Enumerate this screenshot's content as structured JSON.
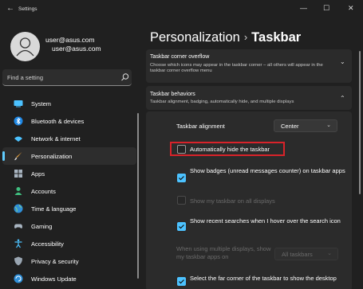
{
  "window": {
    "back_glyph": "←",
    "title": "Settings",
    "minimize_glyph": "—",
    "maximize_glyph": "☐",
    "close_glyph": "✕"
  },
  "account": {
    "email_line1": "user@asus.com",
    "email_line2": "user@asus.com"
  },
  "search": {
    "placeholder": "Find a setting"
  },
  "sidebar": {
    "items": [
      {
        "label": "System",
        "icon": "monitor-icon",
        "active": false
      },
      {
        "label": "Bluetooth & devices",
        "icon": "bluetooth-icon",
        "active": false
      },
      {
        "label": "Network & internet",
        "icon": "wifi-icon",
        "active": false
      },
      {
        "label": "Personalization",
        "icon": "brush-icon",
        "active": true
      },
      {
        "label": "Apps",
        "icon": "apps-icon",
        "active": false
      },
      {
        "label": "Accounts",
        "icon": "person-icon",
        "active": false
      },
      {
        "label": "Time & language",
        "icon": "globe-icon",
        "active": false
      },
      {
        "label": "Gaming",
        "icon": "controller-icon",
        "active": false
      },
      {
        "label": "Accessibility",
        "icon": "accessibility-icon",
        "active": false
      },
      {
        "label": "Privacy & security",
        "icon": "shield-icon",
        "active": false
      },
      {
        "label": "Windows Update",
        "icon": "update-icon",
        "active": false
      }
    ]
  },
  "breadcrumb": {
    "parent": "Personalization",
    "separator": "›",
    "current": "Taskbar"
  },
  "overflow_card": {
    "title": "Taskbar corner overflow",
    "subtitle": "Choose which icons may appear in the taskbar corner – all others will appear in the taskbar corner overflow menu",
    "chevron": "⌄"
  },
  "behaviors_card": {
    "title": "Taskbar behaviors",
    "subtitle": "Taskbar alignment, badging, automatically hide, and multiple displays",
    "chevron": "⌃"
  },
  "settings": {
    "alignment_label": "Taskbar alignment",
    "alignment_value": "Center",
    "autohide_label": "Automatically hide the taskbar",
    "autohide_checked": false,
    "badges_label": "Show badges (unread messages counter) on taskbar apps",
    "badges_checked": true,
    "all_displays_label": "Show my taskbar on all displays",
    "all_displays_checked": false,
    "recent_searches_label": "Show recent searches when I hover over the search icon",
    "recent_searches_checked": true,
    "multi_display_label": "When using multiple displays, show my taskbar apps on",
    "multi_display_value": "All taskbars",
    "far_corner_label": "Select the far corner of the taskbar to show the desktop",
    "far_corner_checked": true
  },
  "colors": {
    "accent": "#4cc2ff",
    "highlight": "#d8232a"
  }
}
